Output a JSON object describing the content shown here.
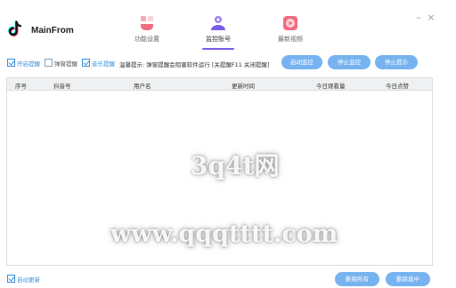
{
  "app": {
    "name": "MainFrom"
  },
  "nav": {
    "tabs": [
      {
        "label": "功能设置",
        "icon": "function-settings-icon",
        "active": false
      },
      {
        "label": "监控账号",
        "icon": "monitor-account-icon",
        "active": true
      },
      {
        "label": "最新视频",
        "icon": "latest-video-icon",
        "active": false
      }
    ]
  },
  "window": {
    "minimize": "–",
    "close": "×"
  },
  "toolbar": {
    "checkboxes": [
      {
        "label": "开启提醒",
        "checked": true
      },
      {
        "label": "弹窗提醒",
        "checked": false
      },
      {
        "label": "音乐提醒",
        "checked": true
      }
    ],
    "notice": "温馨提示: 弹窗提醒会阻塞软件运行 [关提醒F11 关闭提醒]",
    "buttons": {
      "start": "启动监控",
      "stop": "停止监控",
      "stop_alert": "停止提示"
    }
  },
  "table": {
    "columns": [
      "序号",
      "抖音号",
      "用户名",
      "更新时间",
      "今日观看量",
      "今日点赞"
    ],
    "rows": []
  },
  "footer": {
    "auto_update": {
      "label": "自动更新",
      "checked": true
    },
    "delete_all": "删除所有",
    "delete_selected": "删除选中"
  },
  "watermark": {
    "line1": "3q4t网",
    "line2": "www.qqqtttt.com"
  },
  "colors": {
    "accent_blue": "#3b8fd9",
    "button_blue": "#77b3f0",
    "active_tab_underline": "#7a5ce6",
    "tiktok_red": "#fe2c55",
    "tiktok_cyan": "#25f4ee"
  }
}
